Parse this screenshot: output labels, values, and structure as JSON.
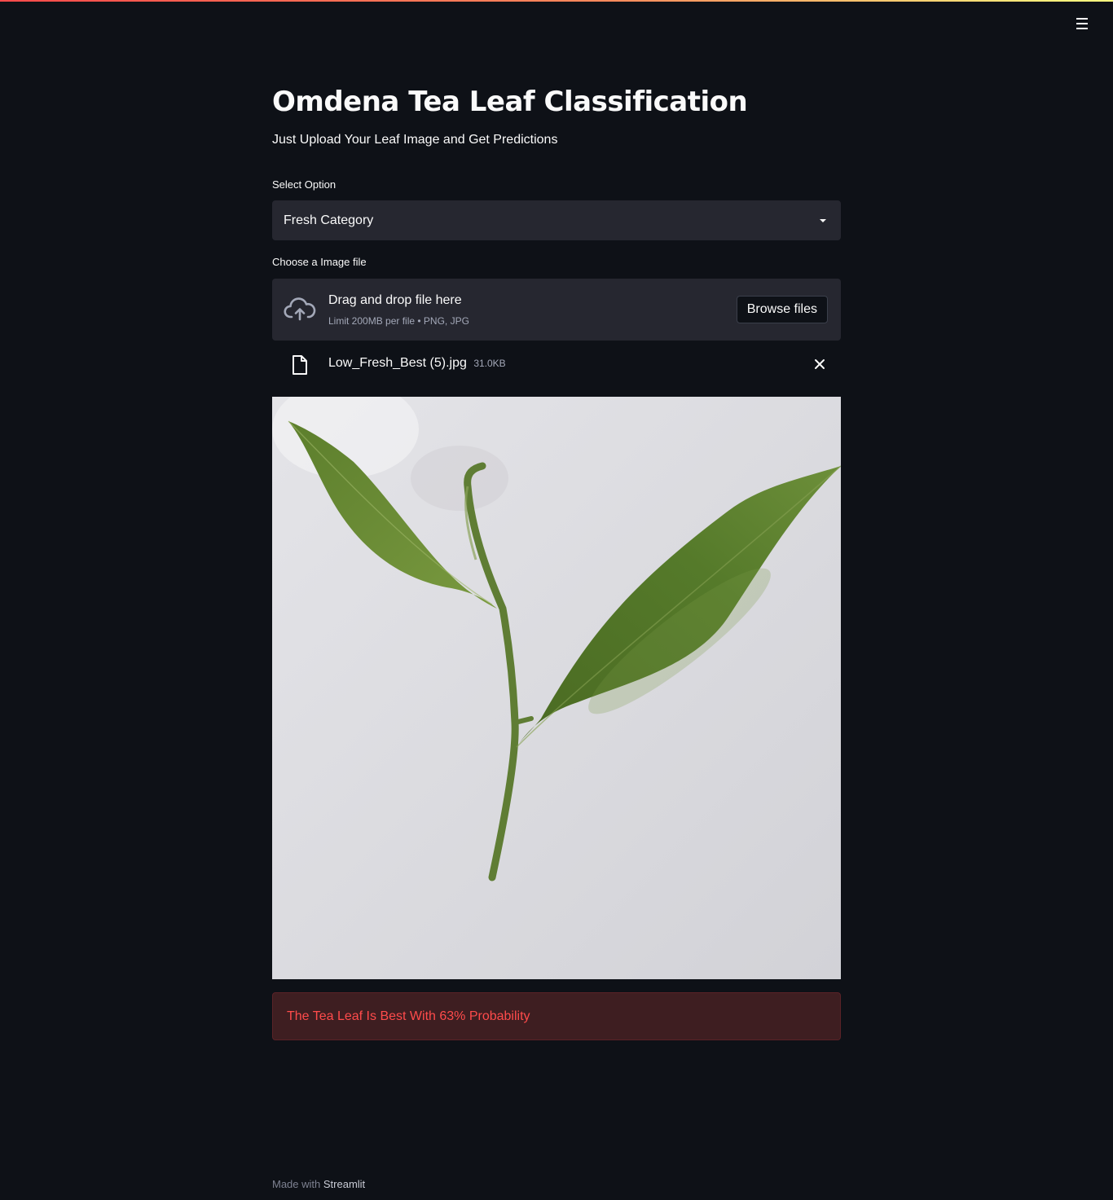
{
  "header": {
    "menu_icon": "hamburger-menu-icon",
    "accent_gradient": [
      "#ff4b4b",
      "#ff8a5c",
      "#fffd80"
    ]
  },
  "page": {
    "title": "Omdena Tea Leaf Classification",
    "subtitle": "Just Upload Your Leaf Image and Get Predictions"
  },
  "select": {
    "label": "Select Option",
    "value": "Fresh Category",
    "icon": "caret-down-icon"
  },
  "uploader": {
    "label": "Choose a Image file",
    "drop_text": "Drag and drop file here",
    "limit_text": "Limit 200MB per file • PNG, JPG",
    "browse_label": "Browse files",
    "icon": "cloud-upload-icon"
  },
  "uploaded_file": {
    "name": "Low_Fresh_Best (5).jpg",
    "size": "31.0KB",
    "icon": "file-icon",
    "remove_icon": "close-icon"
  },
  "result": {
    "message": "The Tea Leaf Is Best With 63% Probability",
    "color": "#ff4b4b",
    "background": "#3e1e21"
  },
  "footer": {
    "prefix": "Made with",
    "link": "Streamlit"
  },
  "colors": {
    "background": "#0e1117",
    "widget": "#262730",
    "text": "#fafafa",
    "muted": "#a3a8b8"
  }
}
